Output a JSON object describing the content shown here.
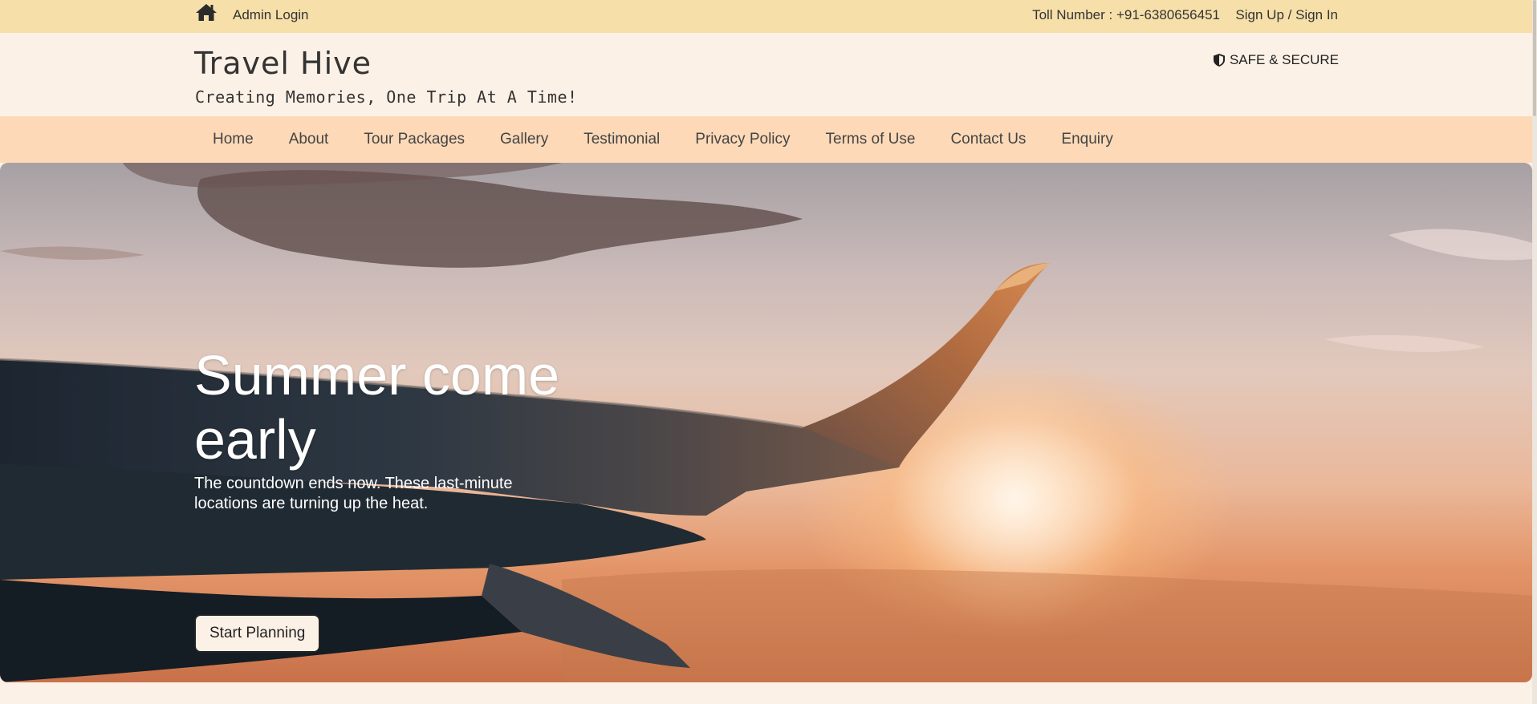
{
  "topbar": {
    "admin_login": "Admin Login",
    "toll_number": "Toll Number : +91-6380656451",
    "signin": "Sign Up / Sign In",
    "icon": "home-icon",
    "bg_color": "#f6dfa9"
  },
  "header": {
    "title": "Travel Hive",
    "tagline": "Creating Memories, One Trip At A Time!",
    "safe_secure": "SAFE & SECURE",
    "safe_icon": "shield-icon"
  },
  "nav": {
    "bg_color": "#fdd9b8",
    "items": [
      {
        "label": "Home"
      },
      {
        "label": "About"
      },
      {
        "label": "Tour Packages"
      },
      {
        "label": "Gallery"
      },
      {
        "label": "Testimonial"
      },
      {
        "label": "Privacy Policy"
      },
      {
        "label": "Terms of Use"
      },
      {
        "label": "Contact Us"
      },
      {
        "label": "Enquiry"
      }
    ]
  },
  "hero": {
    "title": "Summer come early",
    "subtitle": "The countdown ends now. These last-minute locations are turning up the heat.",
    "cta_label": "Start Planning"
  }
}
